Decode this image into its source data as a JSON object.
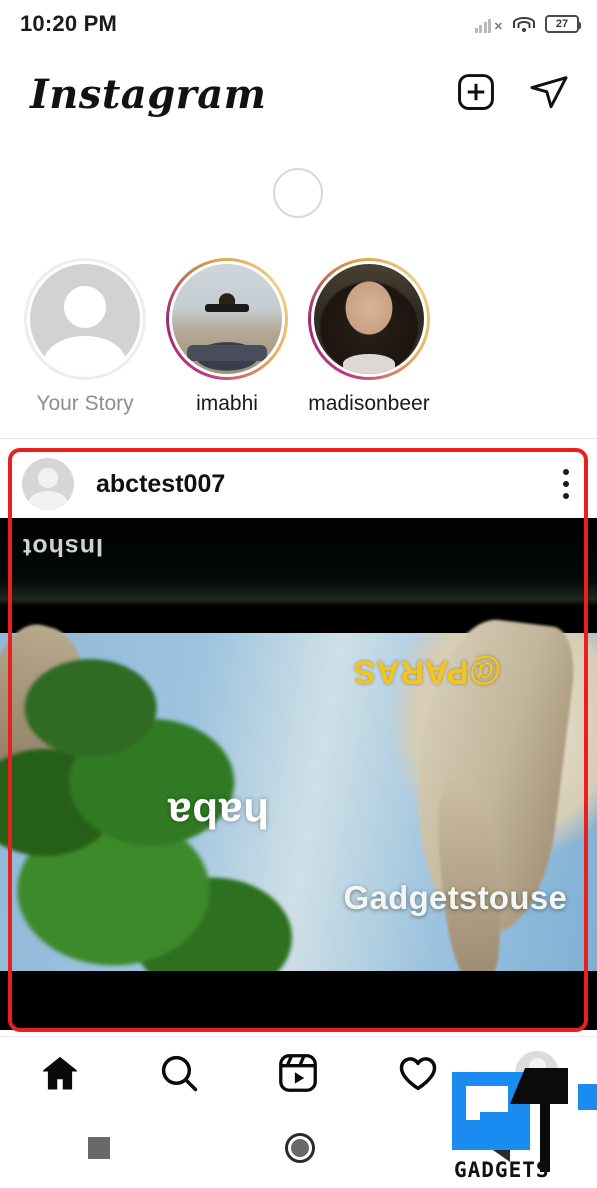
{
  "status_bar": {
    "time": "10:20 PM",
    "battery_percent": "27",
    "signal_icon": "signal-bars-no-sim-icon",
    "wifi_icon": "wifi-icon",
    "battery_icon": "battery-icon"
  },
  "header": {
    "app_title": "Instagram",
    "new_post_icon": "plus-box-icon",
    "direct_message_icon": "paper-plane-icon"
  },
  "refresh": {
    "spinner_name": "loading-spinner"
  },
  "stories": {
    "items": [
      {
        "label": "Your Story",
        "has_ring": false,
        "avatar": "placeholder-avatar"
      },
      {
        "label": "imabhi",
        "has_ring": true,
        "avatar": "photo-avatar"
      },
      {
        "label": "madisonbeer",
        "has_ring": true,
        "avatar": "photo-avatar"
      }
    ]
  },
  "post": {
    "username": "abctest007",
    "avatar": "placeholder-avatar",
    "menu_icon": "three-dot-menu-icon",
    "media": {
      "type": "video",
      "orientation": "upside-down",
      "overlay_texts": {
        "editor_watermark": "Inshot",
        "handle_watermark": "@PARAS",
        "caption_text": "haba",
        "site_watermark": "Gadgetstouse"
      }
    },
    "annotation": {
      "shape": "rectangle",
      "color": "#ea2020"
    }
  },
  "tabbar": {
    "items": [
      {
        "name": "home",
        "icon": "home-icon",
        "active": true
      },
      {
        "name": "search",
        "icon": "search-icon",
        "active": false
      },
      {
        "name": "reels",
        "icon": "reels-icon",
        "active": false
      },
      {
        "name": "activity",
        "icon": "heart-icon",
        "active": false
      },
      {
        "name": "profile",
        "icon": "profile-avatar-icon",
        "active": false
      }
    ]
  },
  "android_nav": {
    "recents_icon": "square-recents-icon",
    "home_icon": "circle-home-icon",
    "back_icon": "triangle-back-icon"
  },
  "watermark": {
    "brand_text": "GADGETS",
    "logo_name": "gadgetstouse-logo",
    "blue": "#1a8bf0"
  }
}
